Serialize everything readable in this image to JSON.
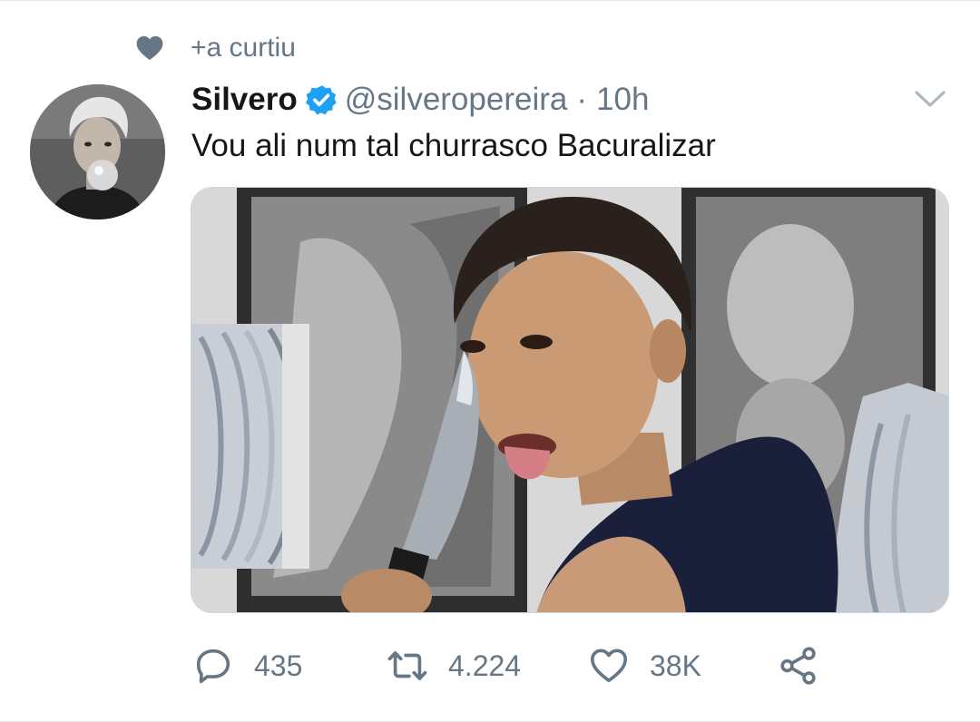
{
  "social_context": {
    "icon": "heart-icon",
    "text": "+a curtiu"
  },
  "tweet": {
    "author_name": "Silvero",
    "verified": true,
    "handle": "@silveropereira",
    "separator": "·",
    "time": "10h",
    "text": "Vou ali num tal churrasco Bacuralizar"
  },
  "actions": {
    "reply_count": "435",
    "retweet_count": "4.224",
    "like_count": "38K"
  },
  "colors": {
    "secondary_text": "#657786",
    "verified_blue": "#1da1f2",
    "icon_gray": "#657786"
  }
}
